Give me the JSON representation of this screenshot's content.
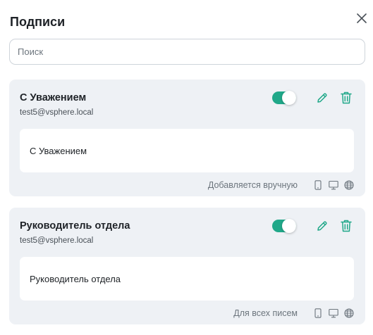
{
  "dialog": {
    "title": "Подписи",
    "close_icon": "close-icon"
  },
  "search": {
    "placeholder": "Поиск",
    "value": ""
  },
  "colors": {
    "accent": "#20a889",
    "card_bg": "#eef1f5",
    "muted_text": "#6c757d"
  },
  "signatures": [
    {
      "name": "С Уважением",
      "email": "test5@vsphere.local",
      "enabled": true,
      "preview": "С Уважением",
      "usage": "Добавляется вручную",
      "icons": [
        "mobile-icon",
        "desktop-icon",
        "web-icon"
      ]
    },
    {
      "name": "Руководитель отдела",
      "email": "test5@vsphere.local",
      "enabled": true,
      "preview": "Руководитель отдела",
      "usage": "Для всех писем",
      "icons": [
        "mobile-icon",
        "desktop-icon",
        "web-icon"
      ]
    }
  ]
}
